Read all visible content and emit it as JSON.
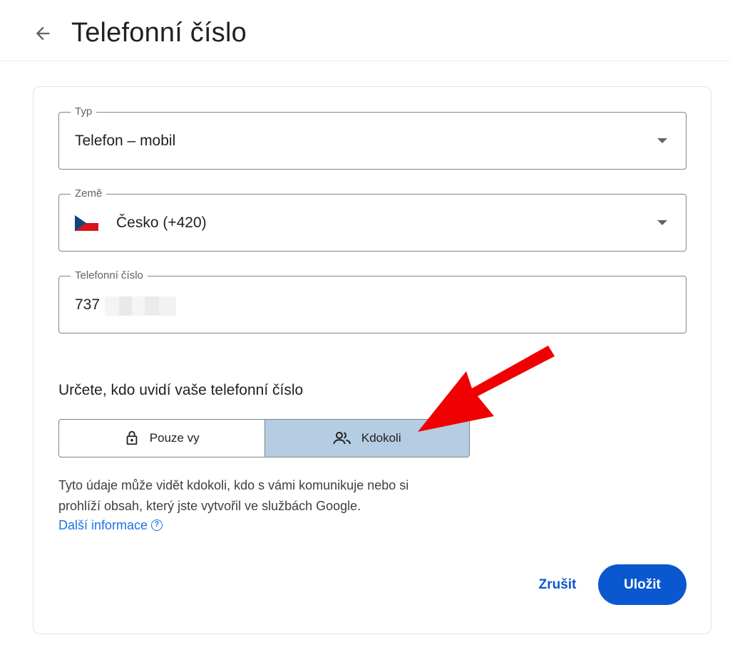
{
  "header": {
    "title": "Telefonní číslo",
    "back_icon": "arrow-left-icon"
  },
  "form": {
    "type_field": {
      "label": "Typ",
      "value": "Telefon – mobil"
    },
    "country_field": {
      "label": "Země",
      "value": "Česko (+420)",
      "flag": "czech-flag-icon"
    },
    "phone_field": {
      "label": "Telefonní číslo",
      "value": "737"
    }
  },
  "visibility": {
    "heading": "Určete, kdo uvidí vaše telefonní číslo",
    "options": [
      {
        "label": "Pouze vy",
        "icon": "lock-icon",
        "selected": false
      },
      {
        "label": "Kdokoli",
        "icon": "people-icon",
        "selected": true
      }
    ],
    "description_line1": "Tyto údaje může vidět kdokoli, kdo s vámi komunikuje nebo si",
    "description_line2": "prohlíží obsah, který jste vytvořil ve službách Google.",
    "learn_more": "Další informace"
  },
  "actions": {
    "cancel_label": "Zrušit",
    "save_label": "Uložit"
  },
  "colors": {
    "accent": "#0b57d0",
    "selected_bg": "#b5cde2",
    "annotation_arrow": "#ff0000"
  }
}
